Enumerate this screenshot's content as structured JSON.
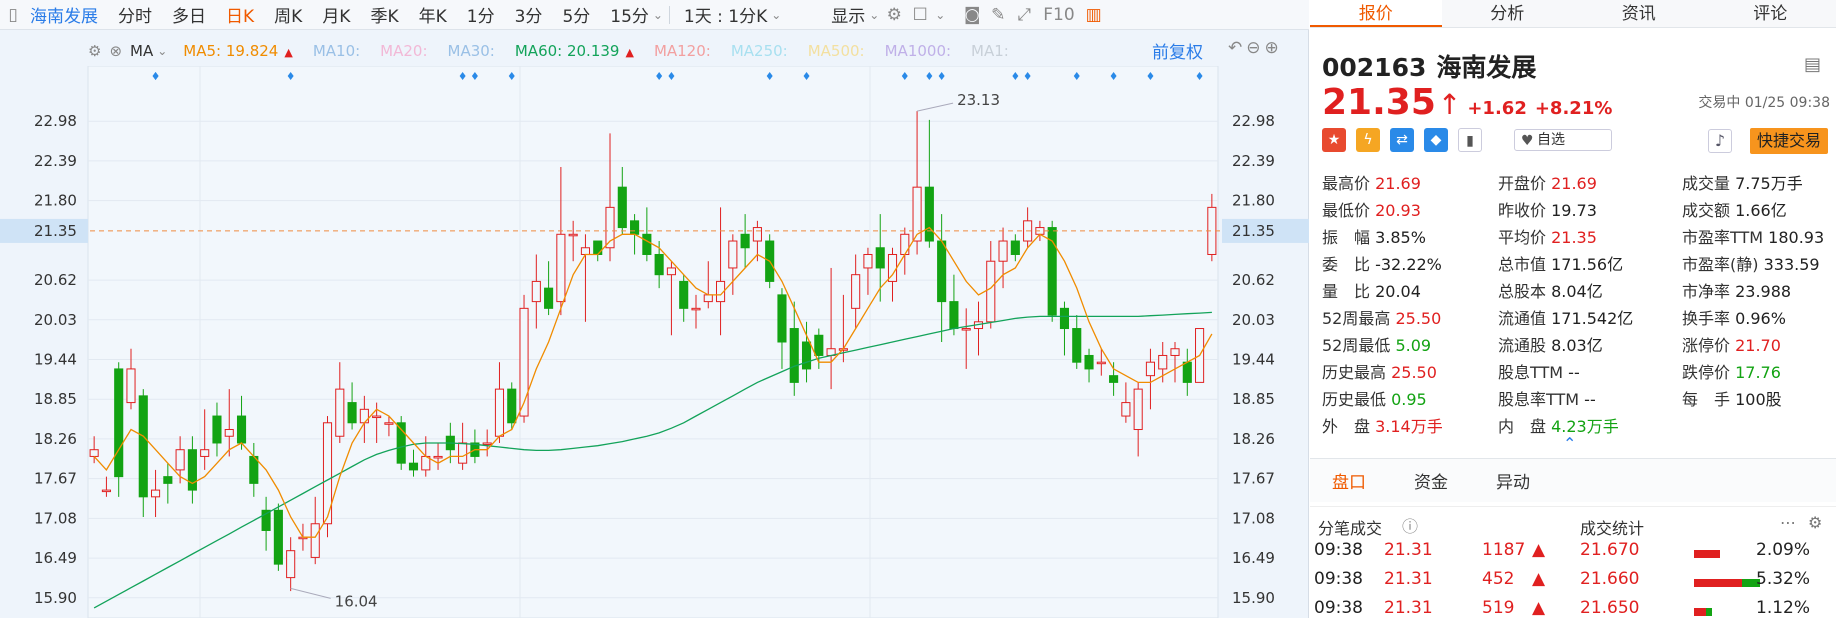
{
  "toolbar": {
    "stock_name": "海南发展",
    "periods": [
      "分时",
      "多日",
      "日K",
      "周K",
      "月K",
      "季K",
      "年K",
      "1分",
      "3分",
      "5分",
      "15分"
    ],
    "active_period": "日K",
    "range_label": "1天 : 1分K",
    "display_label": "显示",
    "f10_label": "F10"
  },
  "ma_bar": {
    "ma_label": "MA",
    "items": [
      {
        "text": "MA5: 19.824",
        "color": "#f08c00",
        "arrow": "▲"
      },
      {
        "text": "MA10:",
        "color": "#9ac0e6",
        "arrow": ""
      },
      {
        "text": "MA20:",
        "color": "#f2b8d6",
        "arrow": ""
      },
      {
        "text": "MA30:",
        "color": "#9ac0e6",
        "arrow": ""
      },
      {
        "text": "MA60: 20.139",
        "color": "#13a35a",
        "arrow": "▲"
      },
      {
        "text": "MA120:",
        "color": "#f2a0a0",
        "arrow": ""
      },
      {
        "text": "MA250:",
        "color": "#a8e0f0",
        "arrow": ""
      },
      {
        "text": "MA500:",
        "color": "#f3e0a0",
        "arrow": ""
      },
      {
        "text": "MA1000:",
        "color": "#c0b0e8",
        "arrow": ""
      },
      {
        "text": "MA1:",
        "color": "#c8d0d8",
        "arrow": ""
      }
    ],
    "adjust_label": "前复权"
  },
  "chart_data": {
    "type": "candlestick",
    "ylim": [
      15.6,
      23.8
    ],
    "y_ticks": [
      "22.98",
      "22.39",
      "21.80",
      "20.62",
      "20.03",
      "19.44",
      "18.85",
      "18.26",
      "17.67",
      "17.08",
      "16.49",
      "15.90"
    ],
    "current_price_label": "21.35",
    "current_price": 21.35,
    "high_annotation": "23.13",
    "high_value": 23.13,
    "low_annotation": "16.04",
    "low_value": 16.04,
    "candles": [
      [
        18.0,
        18.1,
        18.3,
        17.9
      ],
      [
        17.5,
        17.5,
        17.7,
        17.4
      ],
      [
        19.3,
        17.7,
        19.4,
        17.4
      ],
      [
        18.8,
        19.3,
        19.6,
        18.7
      ],
      [
        18.9,
        17.4,
        19.0,
        17.1
      ],
      [
        17.4,
        17.5,
        17.8,
        17.1
      ],
      [
        17.7,
        17.6,
        17.9,
        17.3
      ],
      [
        17.8,
        18.1,
        18.3,
        17.6
      ],
      [
        18.1,
        17.5,
        18.3,
        17.3
      ],
      [
        18.0,
        18.1,
        18.7,
        17.8
      ],
      [
        18.6,
        18.2,
        18.8,
        18.0
      ],
      [
        18.3,
        18.4,
        19.0,
        18.0
      ],
      [
        18.6,
        18.2,
        18.9,
        18.1
      ],
      [
        18.0,
        17.6,
        18.2,
        17.4
      ],
      [
        17.2,
        16.9,
        17.4,
        16.6
      ],
      [
        17.2,
        16.4,
        17.3,
        16.3
      ],
      [
        16.2,
        16.6,
        16.8,
        16.0
      ],
      [
        16.8,
        16.8,
        17.0,
        16.6
      ],
      [
        16.5,
        17.0,
        17.4,
        16.4
      ],
      [
        17.0,
        18.5,
        18.6,
        16.8
      ],
      [
        18.3,
        19.0,
        19.4,
        18.2
      ],
      [
        18.8,
        18.5,
        19.1,
        18.4
      ],
      [
        18.5,
        18.7,
        18.9,
        18.2
      ],
      [
        18.6,
        18.6,
        18.8,
        18.2
      ],
      [
        18.5,
        18.5,
        18.6,
        18.3
      ],
      [
        18.5,
        17.9,
        18.6,
        17.8
      ],
      [
        17.9,
        17.8,
        18.1,
        17.7
      ],
      [
        17.8,
        18.0,
        18.3,
        17.7
      ],
      [
        18.0,
        18.0,
        18.2,
        17.8
      ],
      [
        18.3,
        18.1,
        18.5,
        17.9
      ],
      [
        17.9,
        18.2,
        18.5,
        17.8
      ],
      [
        18.2,
        18.0,
        18.4,
        17.9
      ],
      [
        18.2,
        18.2,
        18.4,
        18.0
      ],
      [
        18.3,
        19.0,
        19.4,
        18.2
      ],
      [
        19.0,
        18.5,
        19.1,
        18.4
      ],
      [
        18.6,
        20.2,
        20.4,
        18.5
      ],
      [
        20.3,
        20.6,
        21.0,
        19.9
      ],
      [
        20.5,
        20.2,
        20.9,
        20.1
      ],
      [
        20.3,
        21.3,
        22.3,
        20.1
      ],
      [
        21.3,
        21.3,
        21.5,
        20.9
      ],
      [
        21.0,
        21.1,
        21.3,
        20.0
      ],
      [
        21.2,
        21.0,
        21.2,
        20.9
      ],
      [
        21.1,
        21.7,
        22.8,
        20.9
      ],
      [
        22.0,
        21.4,
        22.3,
        21.3
      ],
      [
        21.5,
        21.3,
        21.6,
        21.0
      ],
      [
        21.3,
        21.0,
        21.7,
        20.9
      ],
      [
        21.0,
        20.7,
        21.2,
        20.5
      ],
      [
        20.7,
        20.8,
        20.9,
        19.8
      ],
      [
        20.6,
        20.2,
        20.7,
        20.0
      ],
      [
        20.2,
        20.2,
        20.4,
        19.9
      ],
      [
        20.3,
        20.4,
        20.9,
        20.2
      ],
      [
        20.3,
        20.6,
        21.7,
        19.8
      ],
      [
        20.8,
        21.2,
        21.3,
        20.4
      ],
      [
        21.3,
        21.1,
        21.6,
        20.8
      ],
      [
        21.2,
        21.4,
        21.5,
        20.9
      ],
      [
        21.2,
        20.6,
        21.3,
        20.5
      ],
      [
        20.4,
        19.7,
        20.5,
        19.3
      ],
      [
        19.9,
        19.1,
        20.3,
        18.9
      ],
      [
        19.7,
        19.3,
        20.0,
        19.1
      ],
      [
        19.8,
        19.5,
        19.9,
        19.3
      ],
      [
        19.5,
        19.6,
        20.8,
        19.0
      ],
      [
        19.6,
        19.6,
        20.4,
        19.4
      ],
      [
        20.2,
        20.7,
        21.0,
        19.9
      ],
      [
        20.8,
        21.0,
        21.1,
        20.4
      ],
      [
        21.1,
        20.8,
        21.6,
        20.3
      ],
      [
        20.6,
        21.0,
        21.1,
        20.3
      ],
      [
        21.0,
        21.3,
        21.4,
        20.7
      ],
      [
        21.2,
        22.0,
        23.13,
        21.0
      ],
      [
        22.0,
        21.2,
        23.0,
        21.1
      ],
      [
        21.2,
        20.3,
        21.6,
        19.7
      ],
      [
        20.3,
        19.9,
        20.7,
        19.8
      ],
      [
        19.9,
        19.9,
        20.2,
        19.3
      ],
      [
        19.9,
        20.0,
        20.3,
        19.5
      ],
      [
        20.0,
        20.9,
        21.2,
        19.9
      ],
      [
        20.9,
        21.2,
        21.4,
        20.5
      ],
      [
        21.2,
        21.0,
        21.3,
        20.9
      ],
      [
        21.2,
        21.5,
        21.7,
        21.1
      ],
      [
        21.3,
        21.4,
        21.5,
        21.2
      ],
      [
        21.4,
        20.1,
        21.5,
        20.0
      ],
      [
        20.2,
        19.9,
        20.3,
        19.5
      ],
      [
        19.9,
        19.4,
        20.1,
        19.3
      ],
      [
        19.5,
        19.3,
        19.6,
        19.1
      ],
      [
        19.4,
        19.4,
        19.6,
        19.2
      ],
      [
        19.2,
        19.1,
        19.4,
        18.9
      ],
      [
        18.6,
        18.8,
        19.1,
        18.5
      ],
      [
        18.4,
        19.0,
        19.1,
        18.0
      ],
      [
        19.2,
        19.4,
        19.6,
        18.7
      ],
      [
        19.3,
        19.5,
        19.7,
        19.1
      ],
      [
        19.5,
        19.6,
        19.7,
        19.1
      ],
      [
        19.4,
        19.1,
        19.6,
        18.9
      ],
      [
        19.1,
        19.9,
        19.9,
        19.1
      ],
      [
        21.0,
        21.7,
        21.9,
        20.9
      ]
    ],
    "ma5": [
      18.0,
      17.8,
      18.1,
      18.4,
      18.3,
      18.1,
      17.9,
      17.7,
      17.6,
      17.7,
      17.9,
      18.1,
      18.2,
      18.0,
      17.8,
      17.5,
      17.1,
      16.8,
      16.8,
      17.1,
      17.7,
      18.2,
      18.5,
      18.7,
      18.6,
      18.4,
      18.2,
      18.0,
      17.9,
      18.0,
      18.0,
      18.1,
      18.1,
      18.3,
      18.4,
      18.8,
      19.3,
      19.7,
      20.2,
      20.7,
      21.0,
      21.0,
      21.2,
      21.3,
      21.3,
      21.2,
      21.1,
      20.9,
      20.7,
      20.5,
      20.4,
      20.4,
      20.6,
      20.8,
      21.0,
      20.9,
      20.6,
      20.2,
      19.8,
      19.4,
      19.4,
      19.6,
      19.9,
      20.2,
      20.5,
      20.7,
      21.0,
      21.3,
      21.4,
      21.2,
      20.9,
      20.6,
      20.4,
      20.5,
      20.7,
      20.8,
      21.1,
      21.3,
      21.2,
      20.9,
      20.5,
      20.0,
      19.6,
      19.3,
      19.2,
      19.1,
      19.1,
      19.2,
      19.3,
      19.4,
      19.5,
      19.82
    ],
    "ma60": [
      15.75,
      15.85,
      15.95,
      16.05,
      16.15,
      16.25,
      16.35,
      16.45,
      16.55,
      16.65,
      16.75,
      16.85,
      16.95,
      17.05,
      17.15,
      17.25,
      17.35,
      17.45,
      17.55,
      17.65,
      17.75,
      17.85,
      17.95,
      18.03,
      18.09,
      18.14,
      18.18,
      18.2,
      18.2,
      18.2,
      18.19,
      18.18,
      18.16,
      18.14,
      18.12,
      18.1,
      18.09,
      18.09,
      18.1,
      18.12,
      18.14,
      18.16,
      18.19,
      18.22,
      18.26,
      18.3,
      18.35,
      18.42,
      18.5,
      18.6,
      18.7,
      18.8,
      18.9,
      19.0,
      19.1,
      19.18,
      19.26,
      19.34,
      19.4,
      19.46,
      19.5,
      19.54,
      19.58,
      19.62,
      19.66,
      19.7,
      19.74,
      19.78,
      19.82,
      19.86,
      19.9,
      19.93,
      19.96,
      19.99,
      20.02,
      20.05,
      20.07,
      20.08,
      20.08,
      20.08,
      20.08,
      20.08,
      20.08,
      20.08,
      20.08,
      20.08,
      20.09,
      20.1,
      20.11,
      20.12,
      20.13,
      20.139
    ]
  },
  "quote": {
    "code": "002163",
    "name": "海南发展",
    "price": "21.35",
    "change": "+1.62",
    "change_pct": "+8.21%",
    "status": "交易中 01/25 09:38",
    "zixuan": "自选",
    "quick_trade": "快捷交易"
  },
  "right_tabs": [
    "报价",
    "分析",
    "资讯",
    "评论"
  ],
  "stats": [
    [
      {
        "l": "最高价",
        "v": "21.69",
        "c": "red"
      },
      {
        "l": "开盘价",
        "v": "21.69",
        "c": "red"
      },
      {
        "l": "成交量",
        "v": "7.75万手",
        "c": "blk"
      }
    ],
    [
      {
        "l": "最低价",
        "v": "20.93",
        "c": "red"
      },
      {
        "l": "昨收价",
        "v": "19.73",
        "c": "blk"
      },
      {
        "l": "成交额",
        "v": "1.66亿",
        "c": "blk"
      }
    ],
    [
      {
        "l": "振　幅",
        "v": "3.85%",
        "c": "blk"
      },
      {
        "l": "平均价",
        "v": "21.35",
        "c": "red"
      },
      {
        "l": "市盈率TTM",
        "v": "180.93",
        "c": "blk"
      }
    ],
    [
      {
        "l": "委　比",
        "v": "-32.22%",
        "c": "blk"
      },
      {
        "l": "总市值",
        "v": "171.56亿",
        "c": "blk"
      },
      {
        "l": "市盈率(静)",
        "v": "333.59",
        "c": "blk"
      }
    ],
    [
      {
        "l": "量　比",
        "v": "20.04",
        "c": "blk"
      },
      {
        "l": "总股本",
        "v": "8.04亿",
        "c": "blk"
      },
      {
        "l": "市净率",
        "v": "23.988",
        "c": "blk"
      }
    ],
    [
      {
        "l": "52周最高",
        "v": "25.50",
        "c": "red"
      },
      {
        "l": "流通值",
        "v": "171.542亿",
        "c": "blk"
      },
      {
        "l": "换手率",
        "v": "0.96%",
        "c": "blk"
      }
    ],
    [
      {
        "l": "52周最低",
        "v": "5.09",
        "c": "green"
      },
      {
        "l": "流通股",
        "v": "8.03亿",
        "c": "blk"
      },
      {
        "l": "涨停价",
        "v": "21.70",
        "c": "red"
      }
    ],
    [
      {
        "l": "历史最高",
        "v": "25.50",
        "c": "red"
      },
      {
        "l": "股息TTM",
        "v": "--",
        "c": "blk"
      },
      {
        "l": "跌停价",
        "v": "17.76",
        "c": "green"
      }
    ],
    [
      {
        "l": "历史最低",
        "v": "0.95",
        "c": "green"
      },
      {
        "l": "股息率TTM",
        "v": "--",
        "c": "blk"
      },
      {
        "l": "每　手",
        "v": "100股",
        "c": "blk"
      }
    ],
    [
      {
        "l": "外　盘",
        "v": "3.14万手",
        "c": "red"
      },
      {
        "l": "内　盘",
        "v": "4.23万手",
        "c": "green"
      }
    ]
  ],
  "bottom_tabs": [
    "盘口",
    "资金",
    "异动"
  ],
  "trades_head": {
    "left": "分笔成交",
    "right": "成交统计"
  },
  "trades": [
    {
      "time": "09:38",
      "price": "21.31",
      "vol": "1187",
      "stat_price": "21.670",
      "pct": "2.09%",
      "red": 0.22,
      "green": 0
    },
    {
      "time": "09:38",
      "price": "21.31",
      "vol": "452",
      "stat_price": "21.660",
      "pct": "5.32%",
      "red": 0.4,
      "green": 0.15
    },
    {
      "time": "09:38",
      "price": "21.31",
      "vol": "519",
      "stat_price": "21.650",
      "pct": "1.12%",
      "red": 0.1,
      "green": 0.05
    }
  ]
}
